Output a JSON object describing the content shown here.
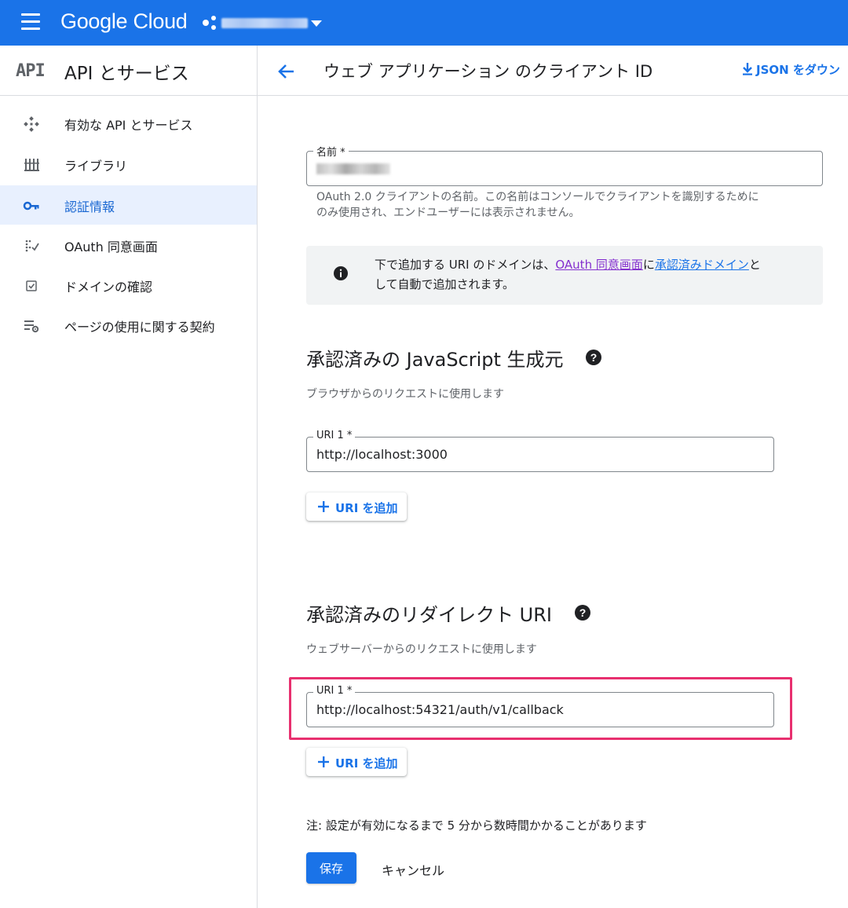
{
  "topbar": {
    "logo": "Google Cloud",
    "menu_icon": "hamburger-menu-icon",
    "project_icon": "project-hierarchy-icon",
    "accent_color": "#1a73e8"
  },
  "sidebar": {
    "logo_text": "API",
    "title": "API とサービス",
    "items": [
      {
        "label": "有効な API とサービス",
        "icon": "enabled-apis-icon",
        "active": false
      },
      {
        "label": "ライブラリ",
        "icon": "library-icon",
        "active": false
      },
      {
        "label": "認証情報",
        "icon": "key-icon",
        "active": true
      },
      {
        "label": "OAuth 同意画面",
        "icon": "oauth-consent-icon",
        "active": false
      },
      {
        "label": "ドメインの確認",
        "icon": "checkbox-icon",
        "active": false
      },
      {
        "label": "ページの使用に関する契約",
        "icon": "settings-list-icon",
        "active": false
      }
    ]
  },
  "header": {
    "title": "ウェブ アプリケーション のクライアント ID",
    "json_button": "JSON をダウン"
  },
  "form": {
    "name_label": "名前 *",
    "name_hint_1": "OAuth 2.0 クライアントの名前。この名前はコンソールでクライアントを識別するために",
    "name_hint_2": "のみ使用され、エンドユーザーには表示されません。",
    "info": {
      "text_before": "下で追加する URI のドメインは、",
      "link_oauth": "OAuth 同意画面",
      "text_mid": "に",
      "link_domains": "承認済みドメイン",
      "text_after": "と",
      "text_line2": "して自動で追加されます。"
    },
    "js_origins": {
      "title": "承認済みの JavaScript 生成元",
      "subtitle": "ブラウザからのリクエストに使用します",
      "uri_label": "URI 1 *",
      "uri_value": "http://localhost:3000",
      "add_button": "URI を追加"
    },
    "redirect_uris": {
      "title": "承認済みのリダイレクト URI",
      "subtitle": "ウェブサーバーからのリクエストに使用します",
      "uri_label": "URI 1 *",
      "uri_value": "http://localhost:54321/auth/v1/callback",
      "add_button": "URI を追加"
    },
    "note": "注: 設定が有効になるまで 5 分から数時間かかることがあります",
    "save_button": "保存",
    "cancel_button": "キャンセル"
  }
}
